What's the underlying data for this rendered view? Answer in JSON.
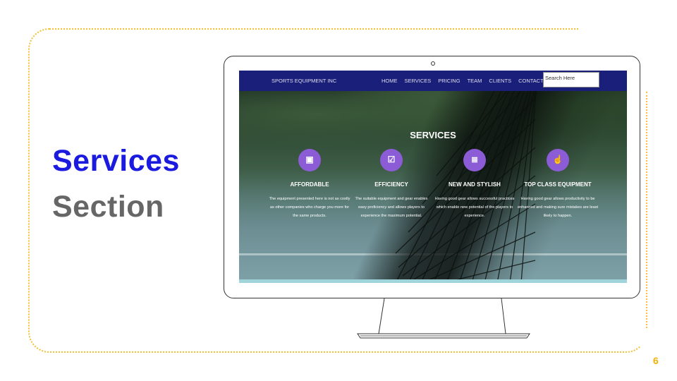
{
  "slide": {
    "title": "Services",
    "subtitle": "Section",
    "page_number": "6"
  },
  "site": {
    "brand": "SPORTS EQUIPMENT INC",
    "nav": [
      "HOME",
      "SERVICES",
      "PRICING",
      "TEAM",
      "CLIENTS",
      "CONTACT"
    ],
    "search_placeholder": "Search Here",
    "section_title": "SERVICES",
    "services": [
      {
        "icon": "money-icon",
        "glyph": "▣",
        "title": "AFFORDABLE",
        "desc": "The equipment presented here is not as costly as other companies who charge you more for the same products."
      },
      {
        "icon": "checkbox-icon",
        "glyph": "☑",
        "title": "EFFICIENCY",
        "desc": "The suitable equipment and gear enables easy proficiency and allows players to experience the maximum potential."
      },
      {
        "icon": "database-icon",
        "glyph": "≣",
        "title": "NEW AND STYLISH",
        "desc": "Having good gear allows successful practices which enable new potential of the players to experience."
      },
      {
        "icon": "thumbs-up-icon",
        "glyph": "☝",
        "title": "TOP CLASS EQUIPMENT",
        "desc": "Having good gear allows productivity to be enhanced and making sure mistakes are least likely to happen."
      }
    ]
  },
  "colors": {
    "accent_blue": "#1b1be0",
    "frame_dots": "#f3c038",
    "nav_bg": "#1a1f7a",
    "icon_purple": "#8c5cd6"
  }
}
